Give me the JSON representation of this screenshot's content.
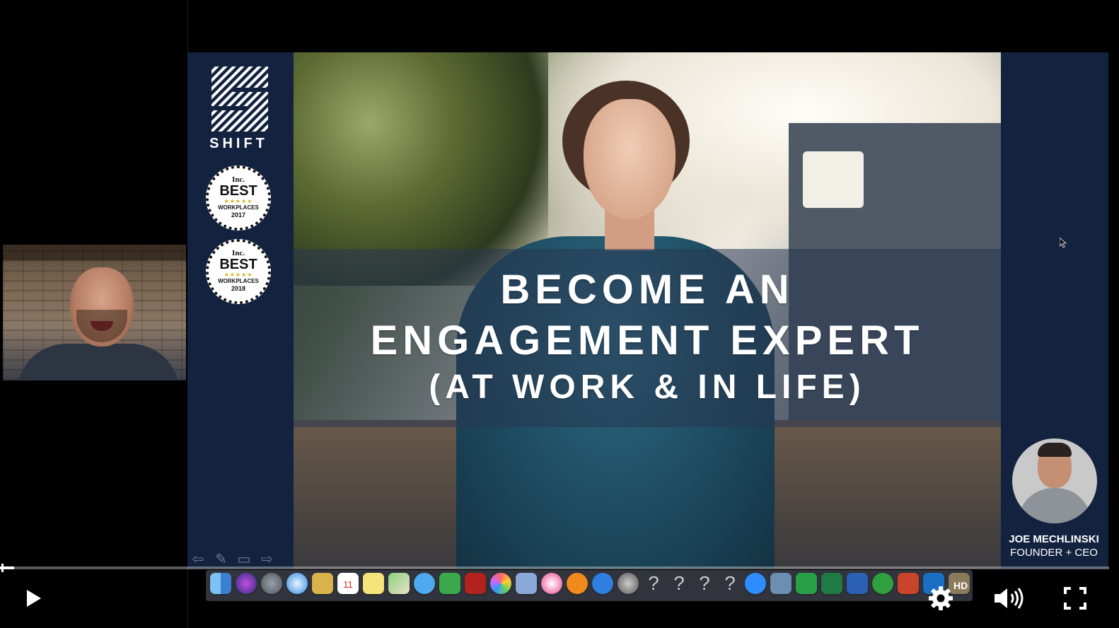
{
  "slide": {
    "brand": "SHIFT",
    "badges": [
      {
        "publisher": "Inc.",
        "label": "BEST",
        "stars": "★★★★★",
        "subtitle": "WORKPLACES",
        "year": "2017"
      },
      {
        "publisher": "Inc.",
        "label": "BEST",
        "stars": "★★★★★",
        "subtitle": "WORKPLACES",
        "year": "2018"
      }
    ],
    "title_lines": [
      "BECOME AN",
      "ENGAGEMENT EXPERT",
      "(AT WORK & IN LIFE)"
    ],
    "presenter": {
      "name": "JOE MECHLINSKI",
      "role": "FOUNDER + CEO"
    },
    "colors": {
      "background": "#13223f",
      "text": "#ffffff"
    }
  },
  "player": {
    "hd_label": "HD",
    "icons": [
      "play-icon",
      "gear-icon",
      "volume-icon",
      "fullscreen-icon"
    ],
    "progress": 0.01
  },
  "dock": {
    "calendar_date": "11",
    "icons": [
      "finder",
      "siri",
      "launchpad",
      "safari",
      "notes",
      "calendar",
      "stickies",
      "maps",
      "messages",
      "facetime",
      "photo-booth",
      "photos",
      "preview",
      "itunes",
      "ibooks",
      "app-store",
      "system-preferences",
      "unknown-1",
      "unknown-2",
      "unknown-3",
      "unknown-4",
      "zoom",
      "skype",
      "excel",
      "word",
      "evernote",
      "powerpoint",
      "outlook",
      "textwrangler",
      "trash"
    ],
    "unknown_glyph": "?"
  }
}
